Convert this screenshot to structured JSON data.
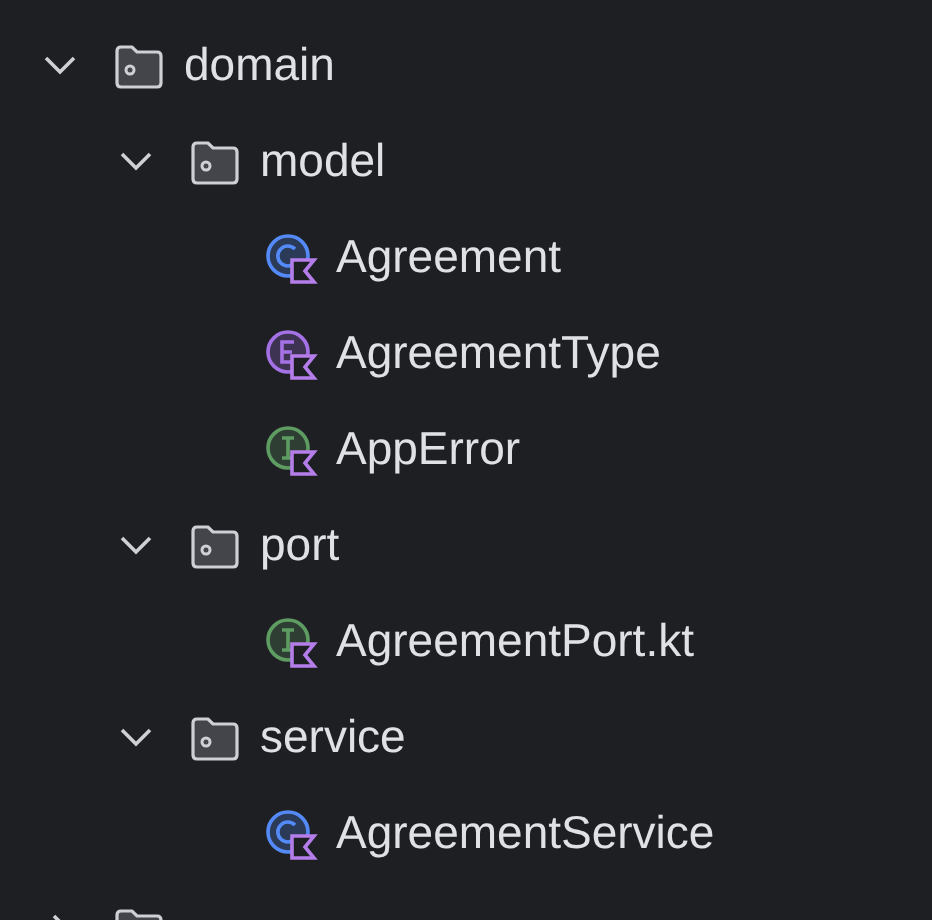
{
  "tree": [
    {
      "kind": "folder",
      "label": "domain",
      "expanded": true,
      "children": [
        {
          "kind": "folder",
          "label": "model",
          "expanded": true,
          "children": [
            {
              "kind": "class",
              "label": "Agreement"
            },
            {
              "kind": "enum",
              "label": "AgreementType"
            },
            {
              "kind": "interface",
              "label": "AppError"
            }
          ]
        },
        {
          "kind": "folder",
          "label": "port",
          "expanded": true,
          "children": [
            {
              "kind": "interface",
              "label": "AgreementPort.kt"
            }
          ]
        },
        {
          "kind": "folder",
          "label": "service",
          "expanded": true,
          "children": [
            {
              "kind": "class",
              "label": "AgreementService"
            }
          ]
        }
      ]
    },
    {
      "kind": "folder",
      "expanded": false
    }
  ]
}
